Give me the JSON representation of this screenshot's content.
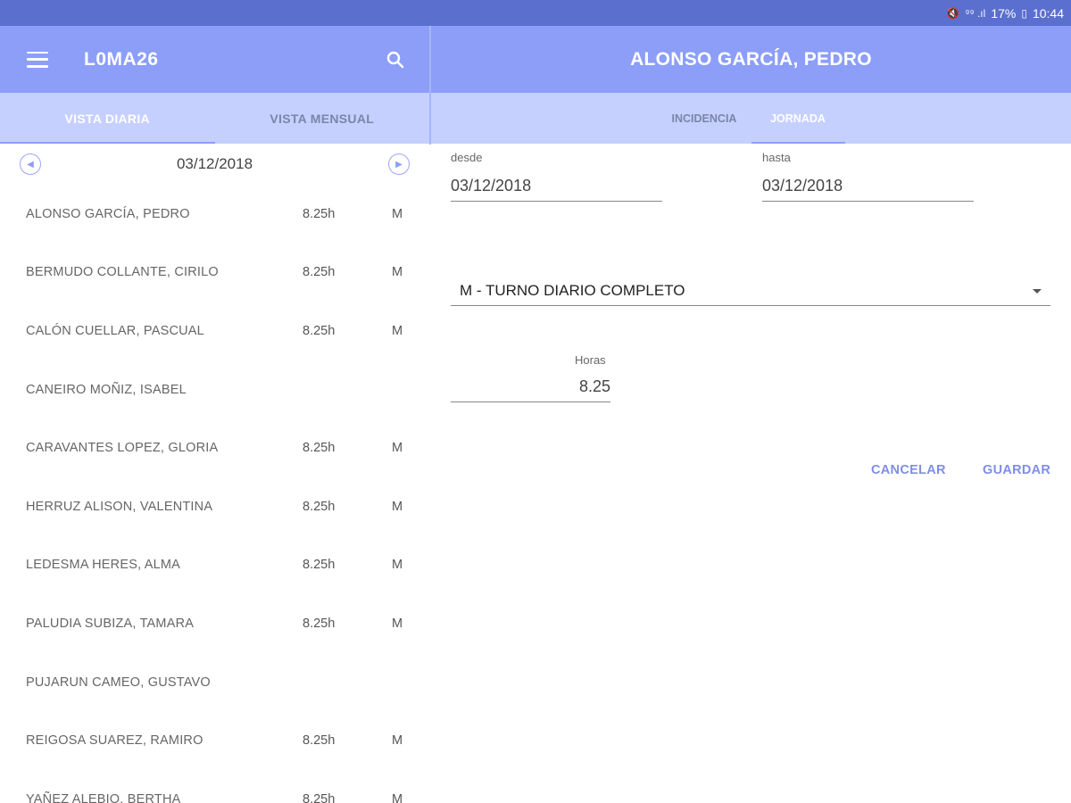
{
  "status_bar": {
    "signal_text": "⁹⁹ .ıl",
    "battery": "17%",
    "time": "10:44"
  },
  "left": {
    "app_title": "L0MA26",
    "tabs": [
      {
        "label": "VISTA DIARIA",
        "active": true
      },
      {
        "label": "VISTA MENSUAL",
        "active": false
      }
    ],
    "date": "03/12/2018",
    "employees": [
      {
        "name": "ALONSO GARCÍA, PEDRO",
        "hours": "8.25h",
        "code": "M"
      },
      {
        "name": "BERMUDO COLLANTE, CIRILO",
        "hours": "8.25h",
        "code": "M"
      },
      {
        "name": "CALÓN CUELLAR, PASCUAL",
        "hours": "8.25h",
        "code": "M"
      },
      {
        "name": "CANEIRO MOÑIZ, ISABEL",
        "hours": "",
        "code": ""
      },
      {
        "name": "CARAVANTES LOPEZ, GLORIA",
        "hours": "8.25h",
        "code": "M"
      },
      {
        "name": "HERRUZ ALISON, VALENTINA",
        "hours": "8.25h",
        "code": "M"
      },
      {
        "name": "LEDESMA HERES, ALMA",
        "hours": "8.25h",
        "code": "M"
      },
      {
        "name": "PALUDIA SUBIZA, TAMARA",
        "hours": "8.25h",
        "code": "M"
      },
      {
        "name": "PUJARUN CAMEO, GUSTAVO",
        "hours": "",
        "code": ""
      },
      {
        "name": "REIGOSA SUAREZ, RAMIRO",
        "hours": "8.25h",
        "code": "M"
      },
      {
        "name": "YAÑEZ ALEBIO, BERTHA",
        "hours": "8.25h",
        "code": "M"
      }
    ]
  },
  "right": {
    "title": "ALONSO GARCÍA, PEDRO",
    "tabs": [
      {
        "label": "INCIDENCIA",
        "active": false
      },
      {
        "label": "JORNADA",
        "active": true
      }
    ],
    "desde_label": "desde",
    "desde_value": "03/12/2018",
    "hasta_label": "hasta",
    "hasta_value": "03/12/2018",
    "turno_value": "M - TURNO DIARIO COMPLETO",
    "horas_label": "Horas",
    "horas_value": "8.25",
    "cancel_label": "CANCELAR",
    "save_label": "GUARDAR"
  },
  "colors": {
    "appbar": "#8c9ef8",
    "tabbar": "#c5d0fe",
    "statusbar": "#5b6fcf",
    "accent_text": "#7f8ee8"
  }
}
